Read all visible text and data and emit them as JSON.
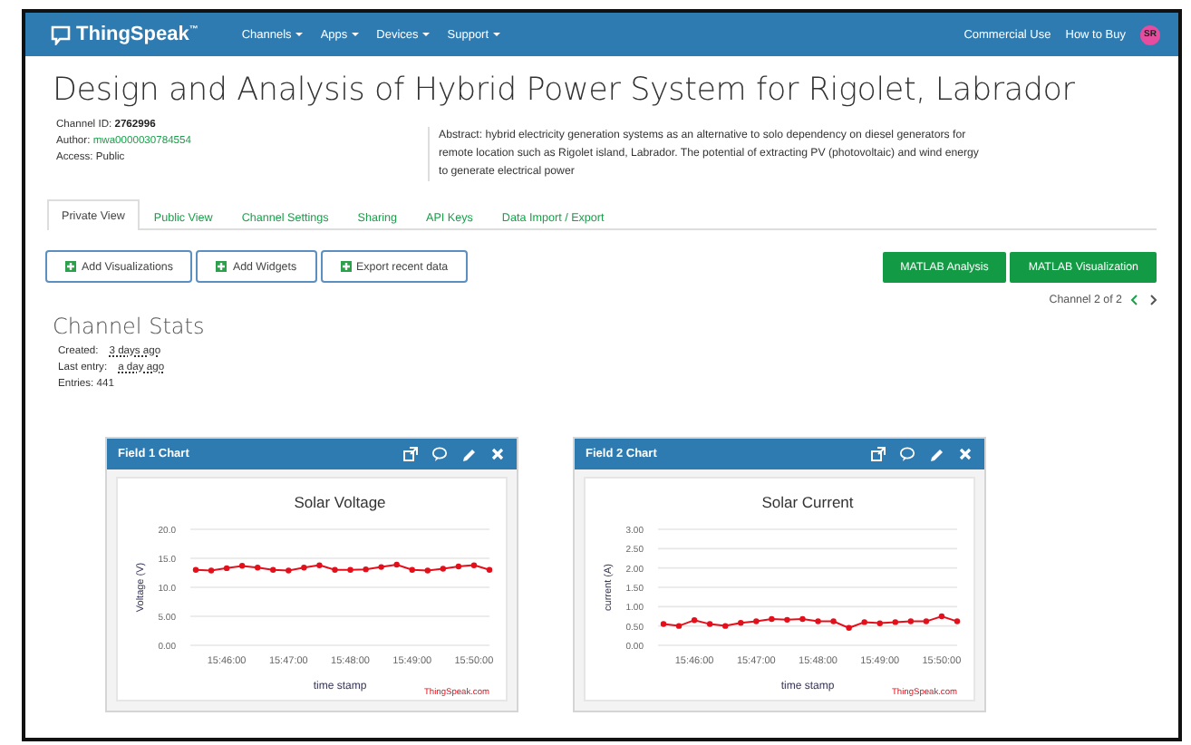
{
  "navbar": {
    "logo": "ThingSpeak$^{™}$",
    "menus": [
      {
        "label": "Channels"
      },
      {
        "label": "Apps"
      },
      {
        "label": "Devices"
      },
      {
        "label": "Support"
      }
    ],
    "links": [
      "Commercial Use",
      "How to Buy"
    ],
    "avatar": "SR"
  },
  "channel": {
    "title": "Design and Analysis of Hybrid Power System for Rigolet, Labrador",
    "info": [
      {
        "label": "Channel ID: ",
        "value": "2762996",
        "kind": "bold"
      },
      {
        "label": "Author: ",
        "value": "mwa0000030784554",
        "kind": "link"
      },
      {
        "label": "Access: ",
        "value": "Public",
        "kind": "plain"
      }
    ],
    "abstract": "Abstract: hybrid electricity generation systems as an alternative to solo dependency on diesel generators for remote location such as Rigolet island, Labrador. The potential of extracting PV (photovoltaic) and wind energy to generate electrical power"
  },
  "tabs": [
    {
      "label": "Private View",
      "selected": true
    },
    {
      "label": "Public View",
      "selected": false
    },
    {
      "label": "Channel Settings",
      "selected": false
    },
    {
      "label": "Sharing",
      "selected": false
    },
    {
      "label": "API Keys",
      "selected": false
    },
    {
      "label": "Data Import / Export",
      "selected": false
    }
  ],
  "actions": [
    {
      "label": "Add Visualizations",
      "kind": "outline"
    },
    {
      "label": "Add Widgets",
      "kind": "outline"
    },
    {
      "label": "Export recent data",
      "kind": "outline"
    },
    {
      "label": "MATLAB Analysis",
      "kind": "solid"
    },
    {
      "label": "MATLAB Visualization",
      "kind": "solid"
    }
  ],
  "pager": "Channel 2 of 2",
  "stats": {
    "heading": "Channel Stats",
    "rows": [
      {
        "label": "Created:",
        "value": "3 days ago"
      },
      {
        "label": "Last entry:",
        "value": "a day ago"
      },
      {
        "label": "Entries: 441"
      }
    ]
  },
  "charts": [
    {
      "header": "Field 1 Chart",
      "chart_data": {
        "type": "line",
        "title": "Solar Voltage",
        "xlabel": "time stamp",
        "ylabel": "Voltage (V)",
        "categories": [
          null,
          null,
          "15:46:00",
          null,
          null,
          null,
          "15:47:00",
          null,
          null,
          null,
          "15:48:00",
          null,
          null,
          null,
          "15:49:00",
          null,
          null,
          null,
          "15:50:00",
          null
        ],
        "grid": true,
        "series": [
          {
            "color": "#e3101b",
            "marker": "circle",
            "values": [
              13.0,
              12.9,
              13.3,
              13.7,
              13.4,
              13.0,
              12.9,
              13.4,
              13.8,
              13.0,
              13.0,
              13.1,
              13.5,
              13.9,
              13.0,
              12.9,
              13.2,
              13.6,
              13.8,
              13.0
            ]
          }
        ],
        "ylim": [
          0,
          20
        ],
        "yticks": [
          {
            "value": 0,
            "label": "0.00"
          },
          {
            "value": 5,
            "label": "5.00"
          },
          {
            "value": 10,
            "label": "10.0"
          },
          {
            "value": 15,
            "label": "15.0"
          },
          {
            "value": 20,
            "label": "20.0"
          }
        ]
      },
      "credit": "ThingSpeak.com"
    },
    {
      "header": "Field 2 Chart",
      "chart_data": {
        "type": "line",
        "title": "Solar Current",
        "xlabel": "time stamp",
        "ylabel": "current (A)",
        "categories": [
          null,
          null,
          "15:46:00",
          null,
          null,
          null,
          "15:47:00",
          null,
          null,
          null,
          "15:48:00",
          null,
          null,
          null,
          "15:49:00",
          null,
          null,
          null,
          "15:50:00",
          null
        ],
        "grid": true,
        "series": [
          {
            "color": "#e3101b",
            "marker": "circle",
            "values": [
              0.55,
              0.5,
              0.65,
              0.55,
              0.5,
              0.58,
              0.62,
              0.68,
              0.66,
              0.68,
              0.62,
              0.62,
              0.45,
              0.6,
              0.57,
              0.6,
              0.62,
              0.62,
              0.75,
              0.62
            ]
          }
        ],
        "ylim": [
          0,
          3
        ],
        "yticks": [
          {
            "value": 0,
            "label": "0.00"
          },
          {
            "value": 0.5,
            "label": "0.50"
          },
          {
            "value": 1,
            "label": "1.00"
          },
          {
            "value": 1.5,
            "label": "1.50"
          },
          {
            "value": 2,
            "label": "2.00"
          },
          {
            "value": 2.5,
            "label": "2.50"
          },
          {
            "value": 3,
            "label": "3.00"
          }
        ]
      },
      "credit": "ThingSpeak.com"
    }
  ]
}
